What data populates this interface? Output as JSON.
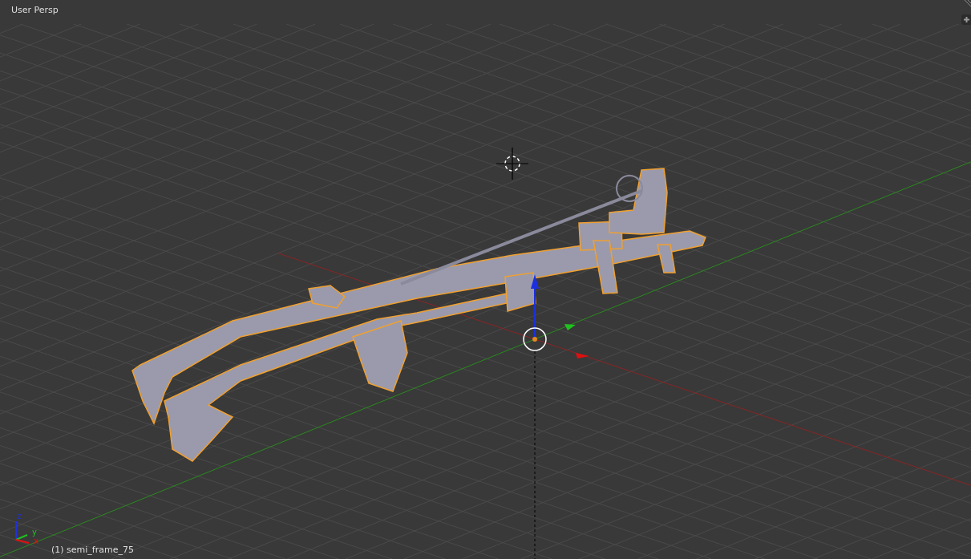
{
  "viewport": {
    "view_name": "User Persp",
    "axis_labels": [
      "z",
      "y",
      "x"
    ]
  },
  "object": {
    "label": "(1) semi_frame_75",
    "selected": true
  }
}
